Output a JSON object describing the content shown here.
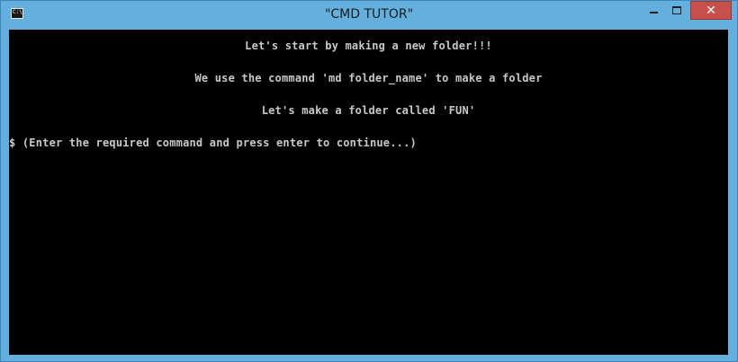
{
  "window": {
    "title": "\"CMD TUTOR\"",
    "icon": "console-app-icon",
    "icon_text": "C:\\",
    "close_glyph": "✕"
  },
  "console": {
    "lines": [
      "Let's start by making a new folder!!!",
      "We use the command 'md folder_name' to make a folder",
      "Let's make a folder called 'FUN'"
    ],
    "prompt_symbol": "$",
    "prompt_hint": "(Enter the required command and press enter to continue...)"
  },
  "colors": {
    "titlebar": "#63b0de",
    "console_bg": "#000000",
    "console_text": "#c8c8c8",
    "close_button": "#c7504a"
  }
}
